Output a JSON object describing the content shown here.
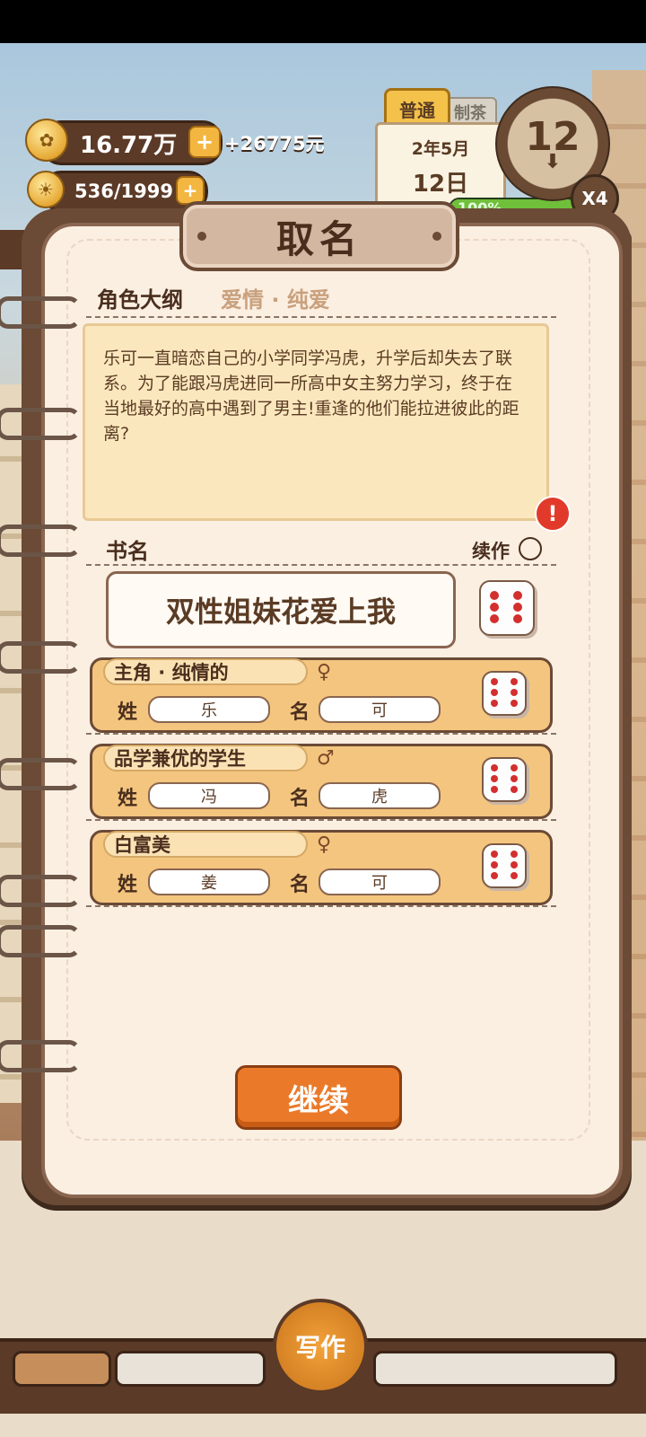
{
  "hud": {
    "money": "16.77万",
    "money_gain": "+26775元",
    "inspiration": "536/1999",
    "mode_tab": "普通",
    "other_tab": "制茶",
    "date_month": "2年5月",
    "date_day": "12日",
    "clock_number": "12",
    "speed": "X4",
    "progress_label": "100%",
    "progress_value": 1.0
  },
  "dialog": {
    "title": "取名",
    "outline_label": "角色大纲",
    "genre": "爱情 · 纯爱",
    "synopsis": "乐可一直暗恋自己的小学同学冯虎，升学后却失去了联系。为了能跟冯虎进同一所高中女主努力学习，终于在当地最好的高中遇到了男主!重逢的他们能拉进彼此的距离?",
    "book_name_label": "书名",
    "sequel_label": "续作",
    "book_name": "双性姐妹花爱上我",
    "surname_label": "姓",
    "given_label": "名",
    "characters": [
      {
        "tag": "主角 · 纯情的",
        "gender_icon": "female-icon",
        "gender_symbol": "♀",
        "surname": "乐",
        "given": "可"
      },
      {
        "tag": "品学兼优的学生",
        "gender_icon": "male-icon",
        "gender_symbol": "♂",
        "surname": "冯",
        "given": "虎"
      },
      {
        "tag": "白富美",
        "gender_icon": "female-icon",
        "gender_symbol": "♀",
        "surname": "姜",
        "given": "可"
      }
    ],
    "continue_label": "继续"
  },
  "bottom": {
    "write_label": "写作"
  },
  "colors": {
    "accent": "#ea7a2a",
    "frame": "#6b4a36",
    "paper": "#fbefe2"
  }
}
